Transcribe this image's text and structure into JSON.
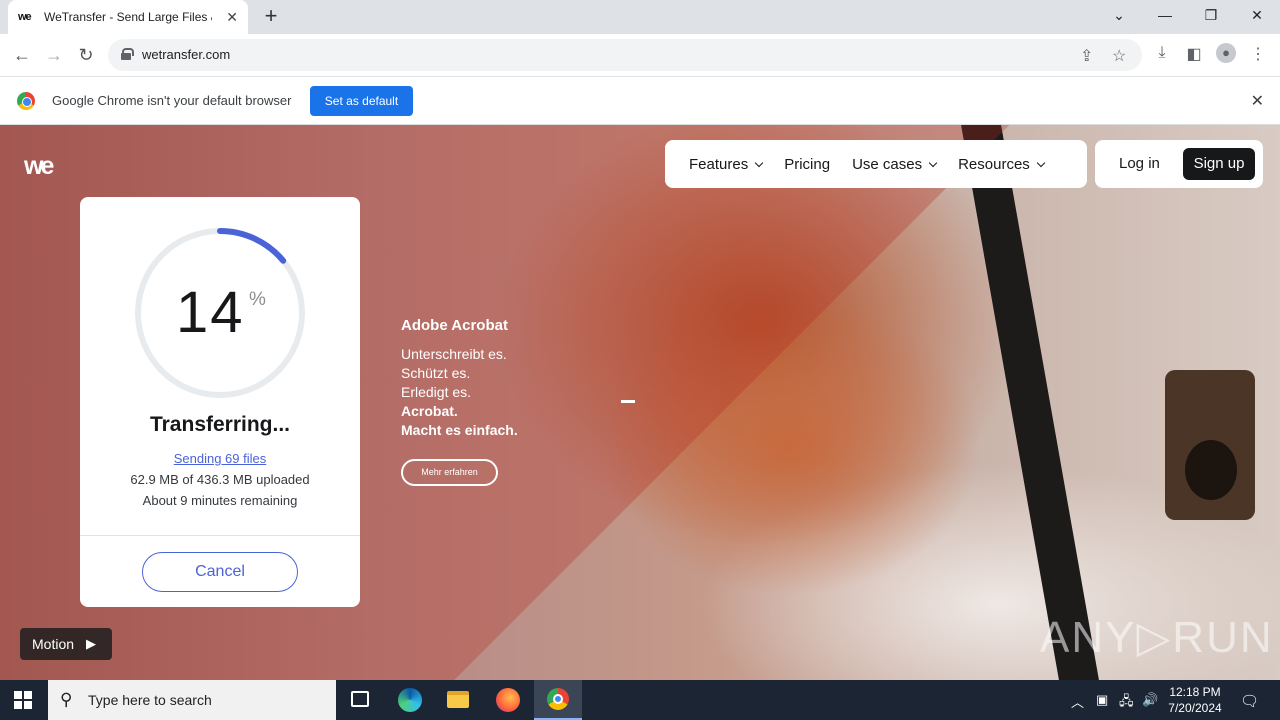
{
  "browser": {
    "tab_title": "WeTransfer - Send Large Files &",
    "tab_favicon": "we",
    "new_tab_glyph": "+",
    "url": "wetransfer.com",
    "window_controls": {
      "dropdown": "⌄",
      "minimize": "—",
      "restore": "❐",
      "close": "✕"
    }
  },
  "infobar": {
    "message": "Google Chrome isn't your default browser",
    "set_default_label": "Set as default",
    "close_glyph": "✕"
  },
  "site": {
    "logo": "we",
    "nav": [
      {
        "label": "Features",
        "has_caret": true
      },
      {
        "label": "Pricing",
        "has_caret": false
      },
      {
        "label": "Use cases",
        "has_caret": true
      },
      {
        "label": "Resources",
        "has_caret": true
      }
    ],
    "login_label": "Log in",
    "signup_label": "Sign up"
  },
  "transfer": {
    "progress": 14,
    "percent_sign": "%",
    "status": "Transferring...",
    "sending": "Sending 69 files",
    "uploaded": "62.9 MB of 436.3 MB uploaded",
    "remaining": "About 9 minutes remaining",
    "cancel_label": "Cancel",
    "ring_track_color": "#e8ebee",
    "ring_progress_color": "#4a63d8"
  },
  "ad": {
    "brand": "Adobe Acrobat",
    "lines": [
      "Unterschreibt es.",
      "Schützt es.",
      "Erledigt es."
    ],
    "bold_lines": [
      "Acrobat.",
      "Macht es einfach."
    ],
    "button_label": "Mehr erfahren"
  },
  "motion": {
    "label": "Motion",
    "play_glyph": "▶"
  },
  "watermark": "ANY▷RUN",
  "taskbar": {
    "search_placeholder": "Type here to search",
    "time": "12:18 PM",
    "date": "7/20/2024",
    "apps": [
      "task-view-icon",
      "edge-icon",
      "file-explorer-icon",
      "firefox-icon",
      "chrome-icon"
    ]
  }
}
